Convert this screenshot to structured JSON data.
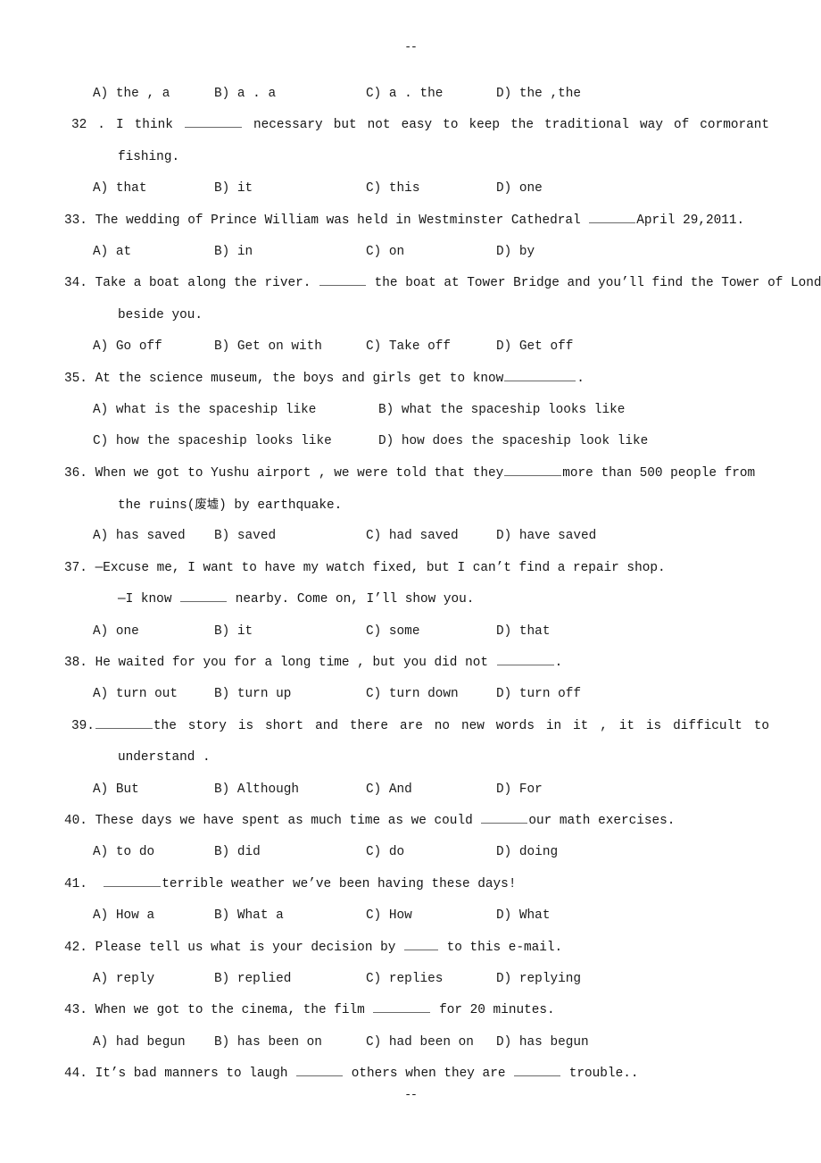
{
  "document": {
    "type": "english-exam-worksheet",
    "page_mark_top": "--",
    "page_mark_bottom": "--"
  },
  "q31_options": {
    "a": "A) the , a",
    "b": "B) a . a",
    "c": "C) a . the",
    "d": "D) the ,the"
  },
  "questions": [
    {
      "number": "32 .",
      "stem_before": "I  think",
      "stem_after": "necessary  but  not  easy  to  keep  the  traditional  way  of  cormorant",
      "continuation": "fishing.",
      "options": {
        "a": "A) that",
        "b": "B) it",
        "c": "C) this",
        "d": "D) one"
      }
    },
    {
      "number": "33.",
      "stem_before": "The wedding of Prince William was held in Westminster Cathedral",
      "stem_after": "April 29,2011.",
      "options": {
        "a": "A) at",
        "b": "B) in",
        "c": "C) on",
        "d": "D) by"
      }
    },
    {
      "number": "34.",
      "stem_before": "Take a boat along the river.",
      "stem_after": "the boat at Tower Bridge and you’ll find the Tower of London",
      "continuation": "beside you.",
      "options": {
        "a": "A) Go off",
        "b": "B) Get on with",
        "c": "C) Take off",
        "d": "D) Get off"
      }
    },
    {
      "number": "35.",
      "stem_before": "At the science museum, the boys and girls get to know",
      "stem_after": ".",
      "options": {
        "a": "A) what is the spaceship like",
        "b": "B) what the spaceship looks like",
        "c": "C) how the spaceship looks like",
        "d": "D) how does the spaceship look like"
      }
    },
    {
      "number": "36.",
      "stem_before": "When  we  got  to  Yushu  airport ,  we  were  told  that  they",
      "stem_after": "more  than  500  people  from",
      "continuation_pre": "the ruins(",
      "continuation_cn": "废墟",
      "continuation_post": ") by earthquake.",
      "options": {
        "a": "A) has saved",
        "b": "B) saved",
        "c": "C) had saved",
        "d": "D) have saved"
      }
    },
    {
      "number": "37.",
      "stem_line1": "—Excuse me, I want to have my watch fixed, but I can’t find a repair shop.",
      "cont_before": "—I know",
      "cont_after": "nearby. Come on, I’ll show you.",
      "options": {
        "a": "A) one",
        "b": "B) it",
        "c": "C) some",
        "d": "D) that"
      }
    },
    {
      "number": "38.",
      "stem_before": "He waited for you for a long time , but you did not",
      "stem_after": ".",
      "options": {
        "a": "A) turn out",
        "b": "B) turn up",
        "c": "C) turn down",
        "d": "D) turn off"
      }
    },
    {
      "number": "39.",
      "stem_after": "the  story  is  short  and  there  are  no  new  words  in  it ,  it  is  difficult  to",
      "continuation": "understand .",
      "options": {
        "a": "A) But",
        "b": "B) Although",
        "c": "C) And",
        "d": "D) For"
      }
    },
    {
      "number": "40.",
      "stem_before": "These days we have spent as much time as we could",
      "stem_after": "our math exercises.",
      "options": {
        "a": "A) to do",
        "b": "B) did",
        "c": "C) do",
        "d": "D) doing"
      }
    },
    {
      "number": "41.",
      "stem_after": "terrible weather we’ve been having these days!",
      "options": {
        "a": "A) How a",
        "b": "B) What a",
        "c": "C) How",
        "d": "D) What"
      }
    },
    {
      "number": "42.",
      "stem_before": "Please tell us what is your decision by",
      "stem_after": "to this e-mail.",
      "options": {
        "a": "A) reply",
        "b": "B) replied",
        "c": "C) replies",
        "d": "D) replying"
      }
    },
    {
      "number": "43.",
      "stem_before": "When we got to the cinema, the film",
      "stem_after": "for 20 minutes.",
      "options": {
        "a": "A) had begun",
        "b": "B) has been on",
        "c": "C) had been on",
        "d": "D) has begun"
      }
    },
    {
      "number": "44.",
      "stem_p1": "It’s bad manners to laugh",
      "stem_p2": "others when they are",
      "stem_p3": "trouble.."
    }
  ]
}
